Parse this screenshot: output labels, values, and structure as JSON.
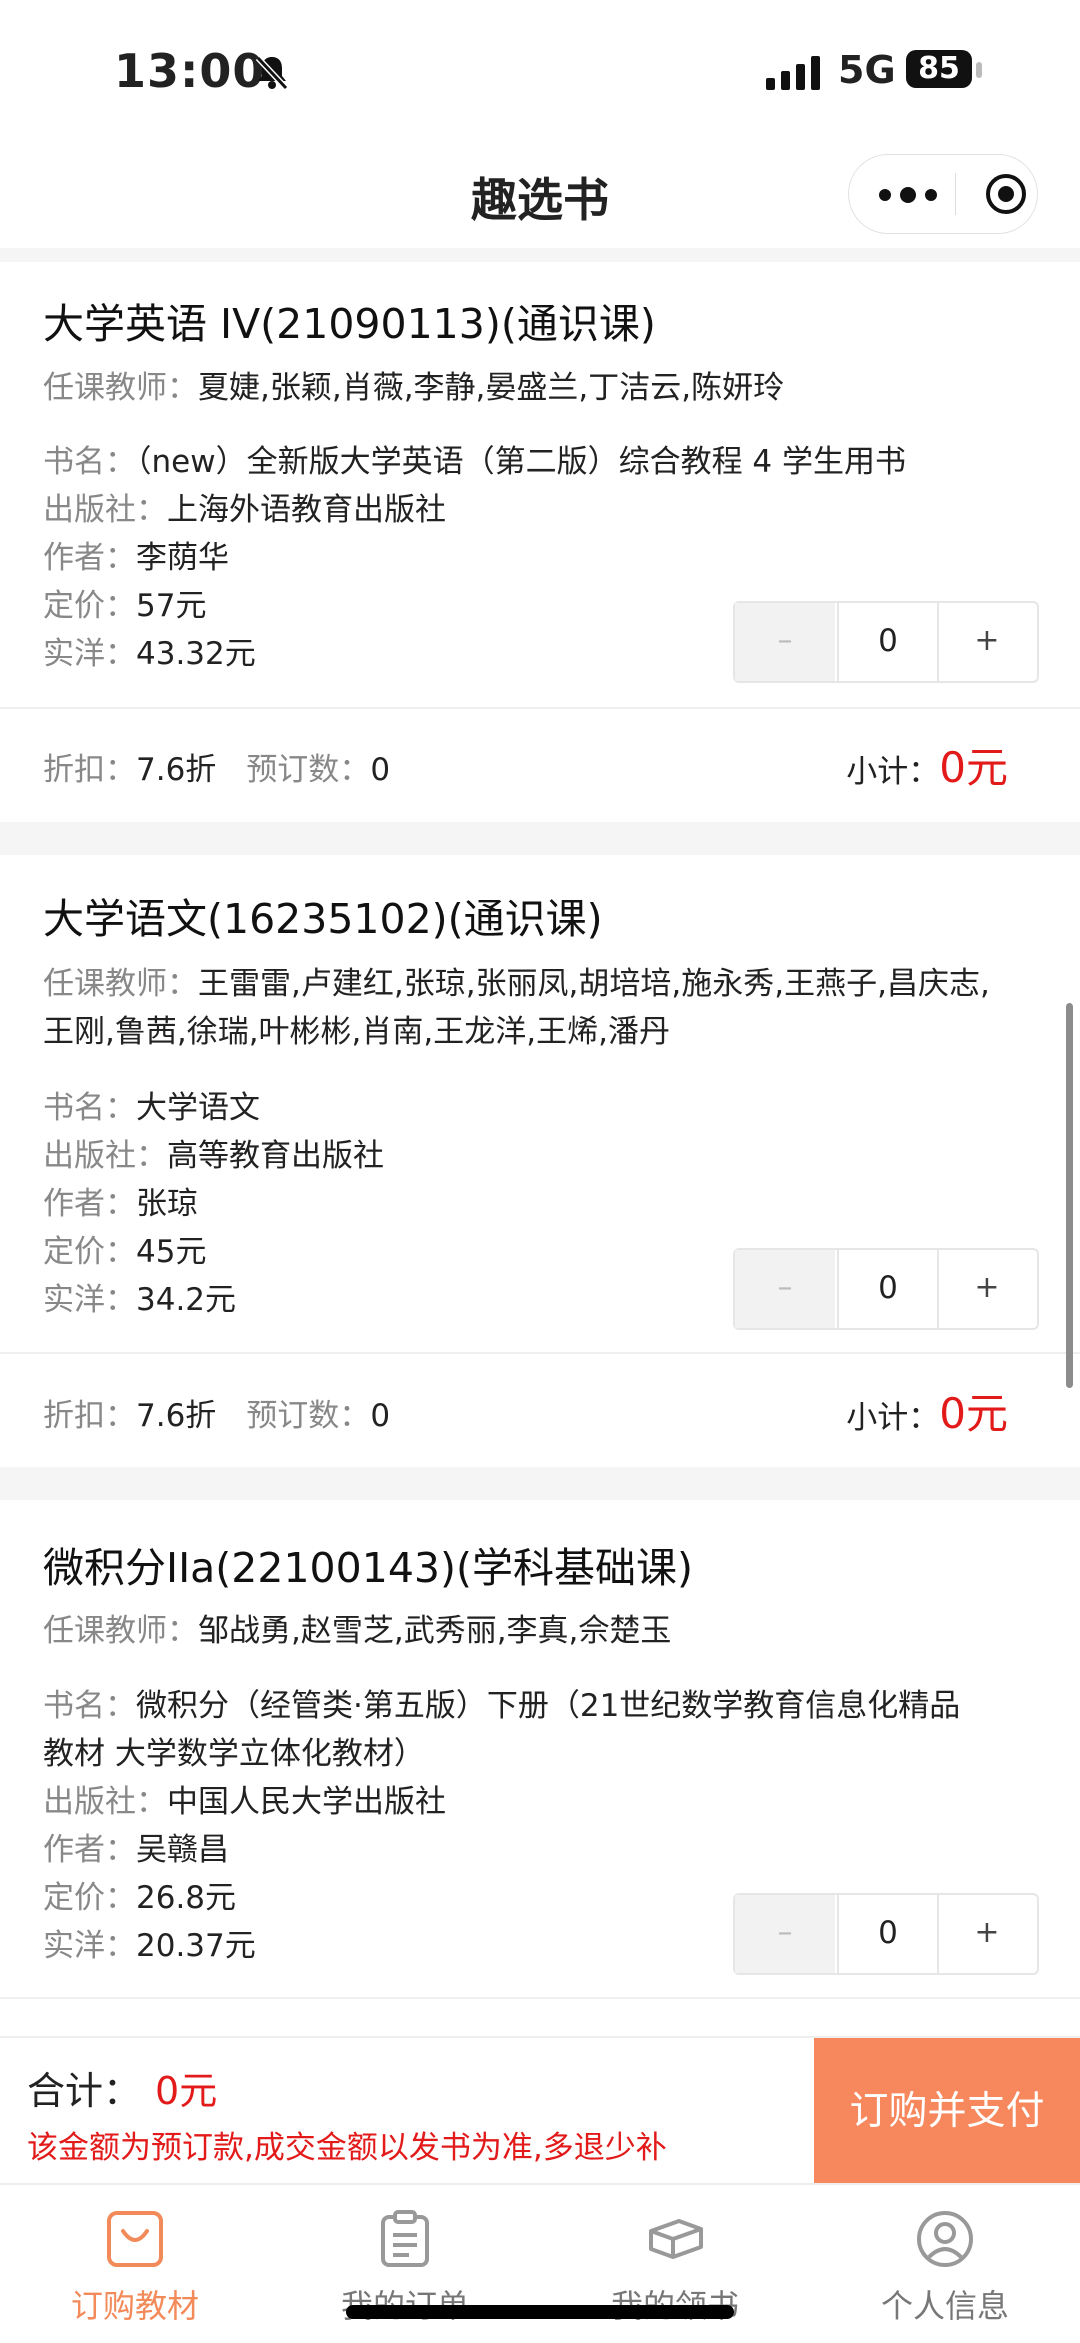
{
  "status_bar": {
    "time": "13:00",
    "network": "5G",
    "battery": "85"
  },
  "nav": {
    "title": "趣选书"
  },
  "courses": [
    {
      "title": "大学英语 IV(21090113)(通识课)",
      "teachers_label": "任课教师：",
      "teachers": "夏婕,张颖,肖薇,李静,晏盛兰,丁洁云,陈妍玲",
      "book_label": "书名：",
      "book": "（new）全新版大学英语（第二版）综合教程 4 学生用书",
      "publisher_label": "出版社：",
      "publisher": "上海外语教育出版社",
      "author_label": "作者：",
      "author": "李荫华",
      "price_label": "定价：",
      "price": "57元",
      "actual_label": "实洋：",
      "actual": "43.32元",
      "minus": "–",
      "qty": "0",
      "plus": "+",
      "discount_label": "折扣：",
      "discount": "7.6折",
      "reserved_label": "预订数：",
      "reserved": "0",
      "subtotal_label": "小计：",
      "subtotal": "0元"
    },
    {
      "title": "大学语文(16235102)(通识课)",
      "teachers_label": "任课教师：",
      "teachers": "王雷雷,卢建红,张琼,张丽凤,胡培培,施永秀,王燕子,昌庆志,",
      "teachers_line2": "王刚,鲁茜,徐瑞,叶彬彬,肖南,王龙洋,王烯,潘丹",
      "book_label": "书名：",
      "book": "大学语文",
      "publisher_label": "出版社：",
      "publisher": "高等教育出版社",
      "author_label": "作者：",
      "author": "张琼",
      "price_label": "定价：",
      "price": "45元",
      "actual_label": "实洋：",
      "actual": "34.2元",
      "minus": "–",
      "qty": "0",
      "plus": "+",
      "discount_label": "折扣：",
      "discount": "7.6折",
      "reserved_label": "预订数：",
      "reserved": "0",
      "subtotal_label": "小计：",
      "subtotal": "0元"
    },
    {
      "title": "微积分IIa(22100143)(学科基础课)",
      "teachers_label": "任课教师：",
      "teachers": "邹战勇,赵雪芝,武秀丽,李真,佘楚玉",
      "book_label": "书名：",
      "book": "微积分（经管类·第五版）下册（21世纪数学教育信息化精品",
      "book_line2": "教材 大学数学立体化教材）",
      "publisher_label": "出版社：",
      "publisher": "中国人民大学出版社",
      "author_label": "作者：",
      "author": "吴赣昌",
      "price_label": "定价：",
      "price": "26.8元",
      "actual_label": "实洋：",
      "actual": "20.37元",
      "minus": "–",
      "qty": "0",
      "plus": "+"
    }
  ],
  "order_bar": {
    "total_label": "合计：",
    "total": "0元",
    "notice": "该金额为预订款,成交金额以发书为准,多退少补",
    "pay_button": "订购并支付"
  },
  "tabs": [
    {
      "label": "订购教材",
      "icon": "shopping-bag-icon",
      "active": true
    },
    {
      "label": "我的订单",
      "icon": "clipboard-icon",
      "active": false
    },
    {
      "label": "我的领书",
      "icon": "book-stack-icon",
      "active": false
    },
    {
      "label": "个人信息",
      "icon": "user-icon",
      "active": false
    }
  ],
  "colors": {
    "accent": "#f7875d",
    "price_red": "#e21a1a",
    "tab_active": "#f28a59"
  }
}
